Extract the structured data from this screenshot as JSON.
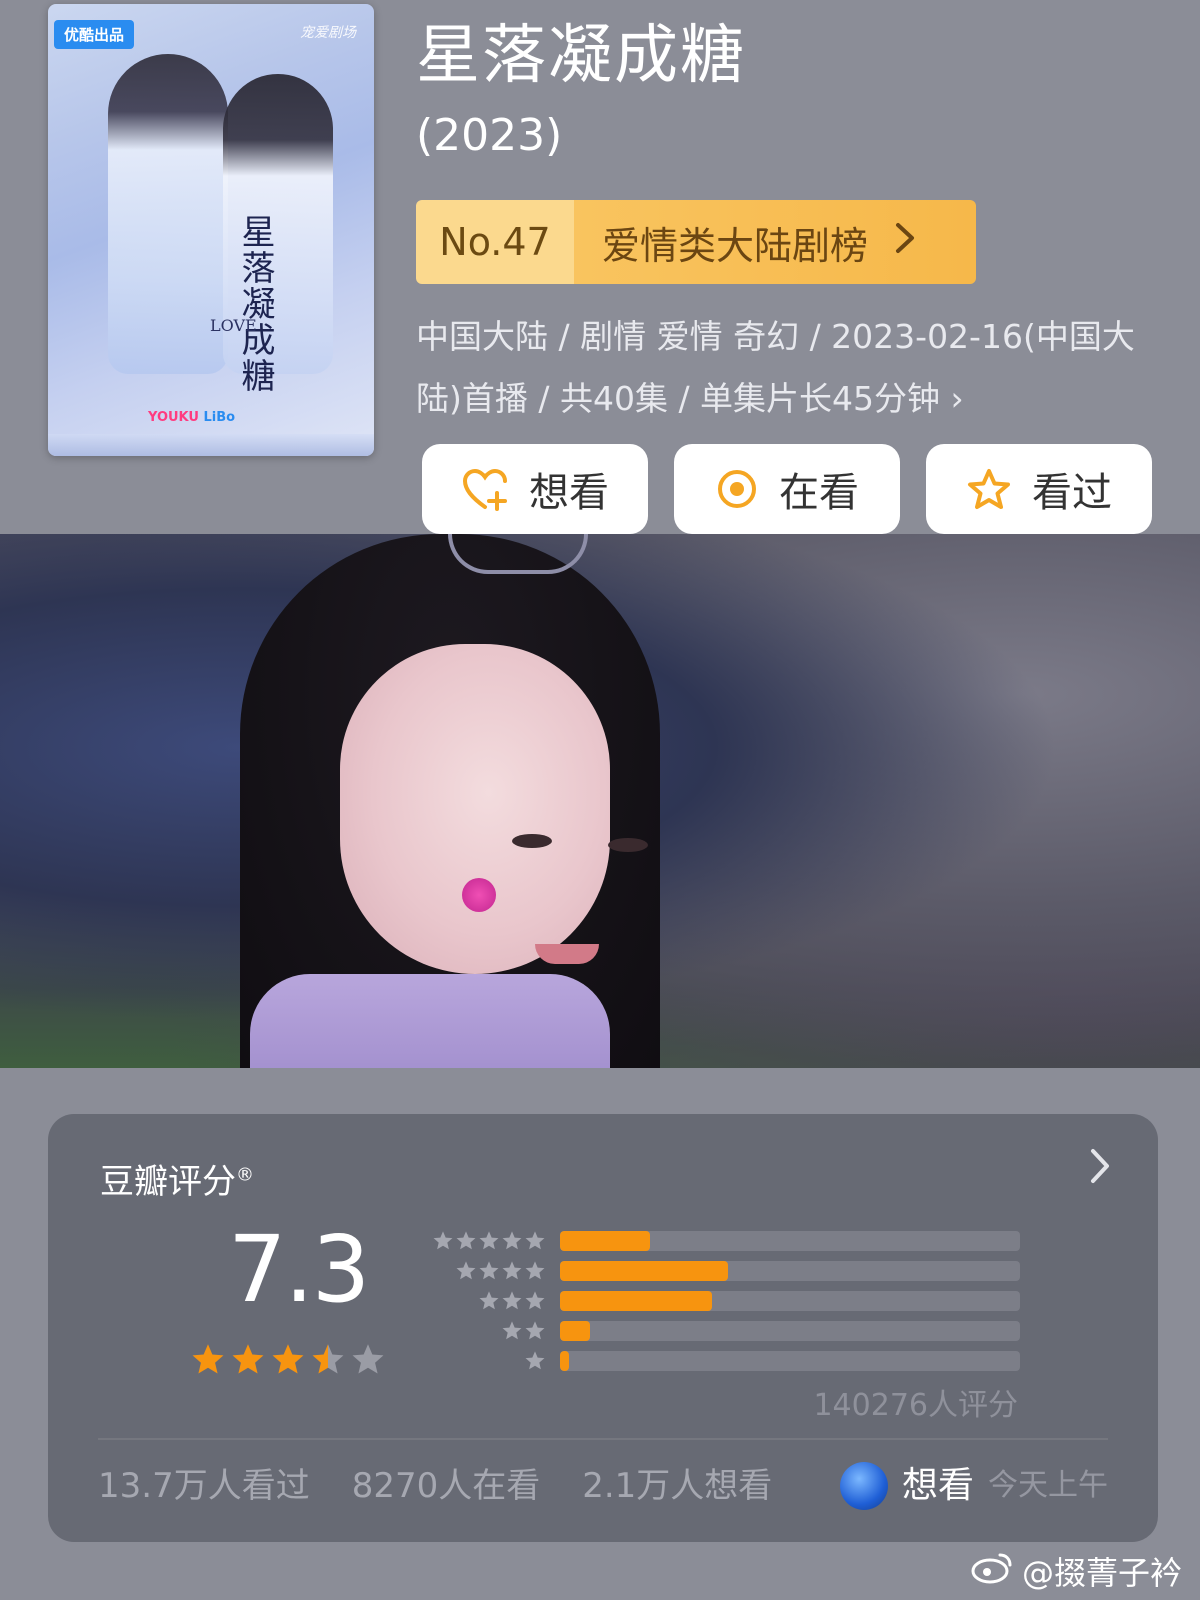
{
  "poster": {
    "badge": "优酷出品",
    "top_brand": "宠爱剧场",
    "calligraphy": "星落凝成糖",
    "love_text": "LOVE",
    "brand_youku": "YOUKU",
    "brand_other": "LiBo"
  },
  "header": {
    "title": "星落凝成糖",
    "year": "(2023)"
  },
  "rank": {
    "number": "No.47",
    "category": "爱情类大陆剧榜"
  },
  "meta": {
    "text": "中国大陆 / 剧情 爱情 奇幻 / 2023-02-16(中国大陆)首播 / 共40集 / 单集片长45分钟 ›"
  },
  "actions": {
    "want": "想看",
    "watching": "在看",
    "watched": "看过"
  },
  "rating": {
    "label": "豆瓣评分",
    "reg_mark": "®",
    "score": "7.3",
    "stars_value": 3.5,
    "distribution": [
      {
        "stars": 5,
        "fraction": 0.196
      },
      {
        "stars": 4,
        "fraction": 0.365
      },
      {
        "stars": 3,
        "fraction": 0.33
      },
      {
        "stars": 2,
        "fraction": 0.065
      },
      {
        "stars": 1,
        "fraction": 0.02
      }
    ],
    "count": "140276人评分",
    "stats": {
      "watched": "13.7万人看过",
      "watching": "8270人在看",
      "want": "2.1万人想看"
    },
    "friend": {
      "action": "想看",
      "time": "今天上午"
    }
  },
  "watermark": "@掇菁子衿",
  "colors": {
    "background": "#8b8d97",
    "card": "#676a74",
    "accent": "#f7940f",
    "rank_bg": "#f9c45f"
  }
}
